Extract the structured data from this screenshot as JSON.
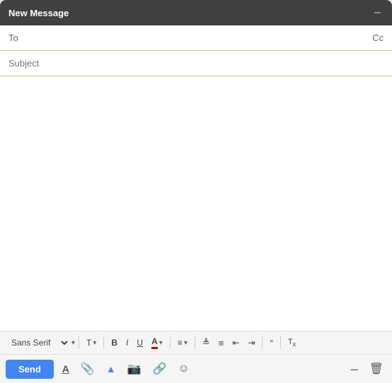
{
  "header": {
    "title": "New Message",
    "minimize_label": "–",
    "expand_label": "⤢",
    "close_label": "✕"
  },
  "to_field": {
    "label": "To",
    "placeholder": "",
    "cc_label": "Cc"
  },
  "subject_field": {
    "label": "Subject",
    "placeholder": "Subject"
  },
  "body": {
    "placeholder": ""
  },
  "formatting": {
    "font_family": "Sans Serif",
    "font_size_label": "T",
    "bold_label": "B",
    "italic_label": "I",
    "underline_label": "U",
    "text_color_label": "A",
    "align_label": "≡",
    "ordered_list_label": "≔",
    "unordered_list_label": "≡",
    "indent_less_label": "⇤",
    "indent_more_label": "⇥",
    "quote_label": "❝",
    "remove_format_label": "Tx"
  },
  "toolbar": {
    "send_label": "Send",
    "format_label": "A",
    "attach_label": "📎",
    "drive_label": "▲",
    "photo_label": "📷",
    "link_label": "🔗",
    "emoji_label": "☺",
    "delete_label": "🗑",
    "minimize_label": "–"
  }
}
